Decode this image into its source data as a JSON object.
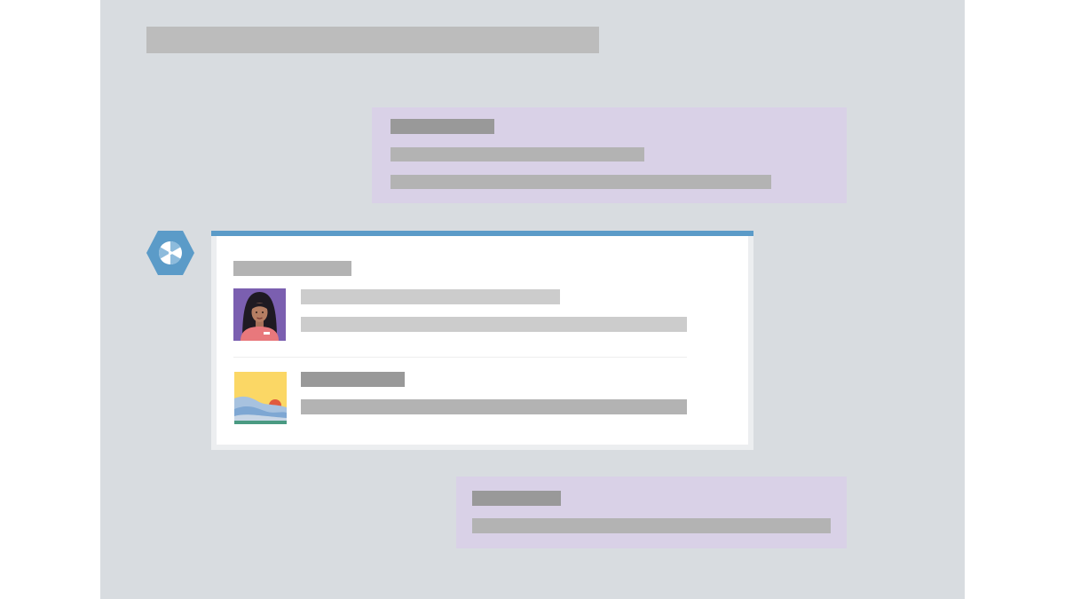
{
  "colors": {
    "background": "#d8dce0",
    "message_bubble": "#d9d1e7",
    "card_accent": "#5b9bc8",
    "bot_icon": "#5b9bc8"
  },
  "icons": {
    "bot": "hexagon-bot-icon",
    "person": "person-avatar-icon",
    "image": "landscape-image-icon"
  }
}
